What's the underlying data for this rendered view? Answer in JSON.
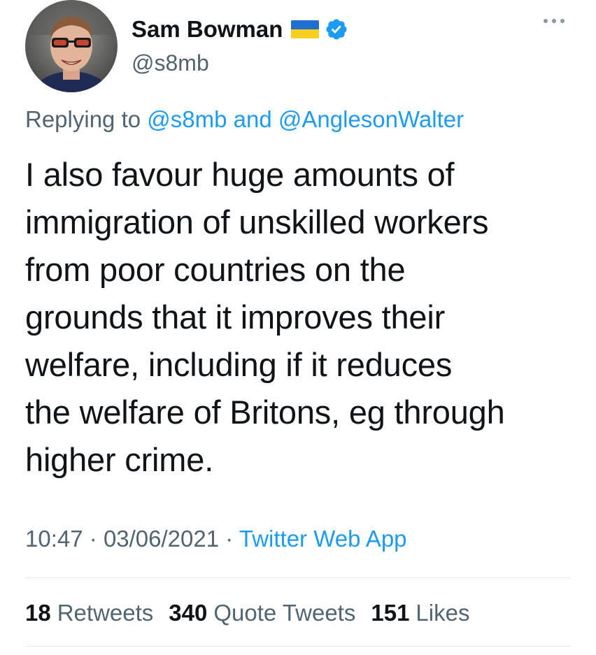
{
  "author": {
    "display_name": "Sam Bowman",
    "handle": "@s8mb",
    "flag_icon": "ukraine-flag-icon",
    "verified_icon": "verified-badge-icon"
  },
  "reply": {
    "prefix": "Replying to",
    "mention_1": "@s8mb",
    "conjunction": "and",
    "mention_2": "@AnglesonWalter"
  },
  "tweet": {
    "lines": [
      "I also favour huge amounts of",
      "immigration of unskilled workers",
      "from poor countries on the",
      "grounds that it improves their",
      "welfare, including if it reduces",
      "the welfare of Britons, eg through",
      "higher crime."
    ]
  },
  "meta": {
    "time": "10:47",
    "separator": "·",
    "date": "03/06/2021",
    "source": "Twitter Web App"
  },
  "stats": {
    "retweets_count": "18",
    "retweets_label": "Retweets",
    "quotes_count": "340",
    "quotes_label": "Quote Tweets",
    "likes_count": "151",
    "likes_label": "Likes"
  },
  "colors": {
    "text": "#0f1419",
    "secondary": "#536471",
    "link": "#1d9bf0",
    "divider": "#e6ecf0"
  }
}
